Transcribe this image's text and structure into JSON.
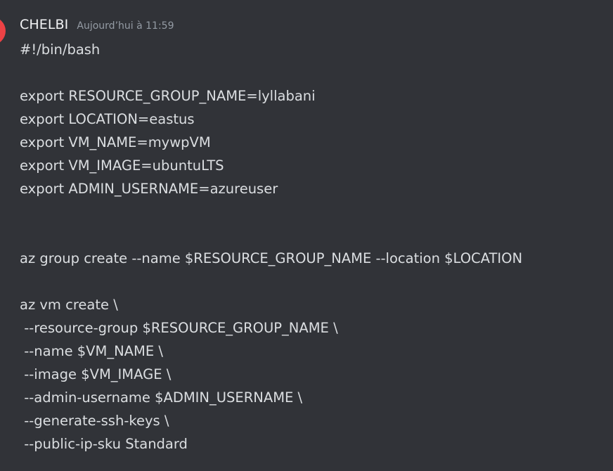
{
  "message": {
    "author": "CHELBI",
    "timestamp": "Aujourd’hui à 11:59",
    "lines": [
      "#!/bin/bash",
      "",
      "export RESOURCE_GROUP_NAME=lyllabani",
      "export LOCATION=eastus",
      "export VM_NAME=mywpVM",
      "export VM_IMAGE=ubuntuLTS",
      "export ADMIN_USERNAME=azureuser",
      "",
      "",
      "az group create --name $RESOURCE_GROUP_NAME --location $LOCATION",
      "",
      "az vm create \\",
      " --resource-group $RESOURCE_GROUP_NAME \\",
      " --name $VM_NAME \\",
      " --image $VM_IMAGE \\",
      " --admin-username $ADMIN_USERNAME \\",
      " --generate-ssh-keys \\",
      " --public-ip-sku Standard"
    ]
  },
  "colors": {
    "background": "#313338",
    "avatar": "#ed4245",
    "username": "#f2f3f5",
    "timestamp": "#949ba4",
    "text": "#dbdee1"
  }
}
